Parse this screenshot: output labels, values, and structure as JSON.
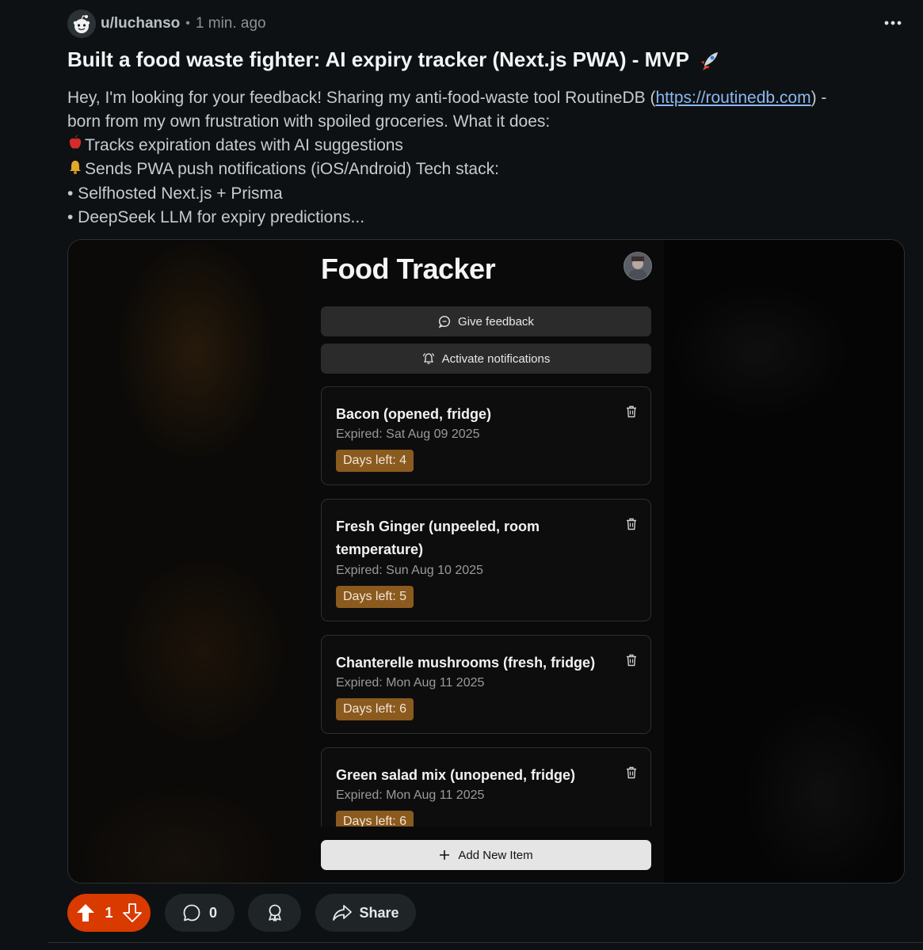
{
  "post": {
    "username": "u/luchanso",
    "separator": "•",
    "time": "1 min. ago",
    "title": "Built a food waste fighter: AI expiry tracker (Next.js PWA) - MVP",
    "body": {
      "intro_before_link": "Hey, I'm looking for your feedback! Sharing my anti-food-waste tool RoutineDB (",
      "link_text": "https://routinedb.com",
      "intro_after_link": ") -",
      "line2": "born from my own frustration with spoiled groceries. What it does:",
      "line3": "Tracks expiration dates with AI suggestions",
      "line4": "Sends PWA push notifications (iOS/Android) Tech stack:",
      "line5": "• Selfhosted Next.js + Prisma",
      "line6": "• DeepSeek LLM for expiry predictions..."
    }
  },
  "app": {
    "title": "Food Tracker",
    "feedback_label": "Give feedback",
    "notifications_label": "Activate notifications",
    "add_label": "Add New Item",
    "items": [
      {
        "name": "Bacon (opened, fridge)",
        "expired": "Expired: Sat Aug 09 2025",
        "days": "Days left: 4"
      },
      {
        "name": "Fresh Ginger (unpeeled, room temperature)",
        "expired": "Expired: Sun Aug 10 2025",
        "days": "Days left: 5"
      },
      {
        "name": "Chanterelle mushrooms (fresh, fridge)",
        "expired": "Expired: Mon Aug 11 2025",
        "days": "Days left: 6"
      },
      {
        "name": "Green salad mix (unopened, fridge)",
        "expired": "Expired: Mon Aug 11 2025",
        "days": "Days left: 6"
      }
    ]
  },
  "actions": {
    "vote_count": "1",
    "comment_count": "0",
    "share_label": "Share"
  },
  "colors": {
    "upvote_active": "#d93a00",
    "badge": "#8a5a1f",
    "link": "#8ab8f0"
  }
}
